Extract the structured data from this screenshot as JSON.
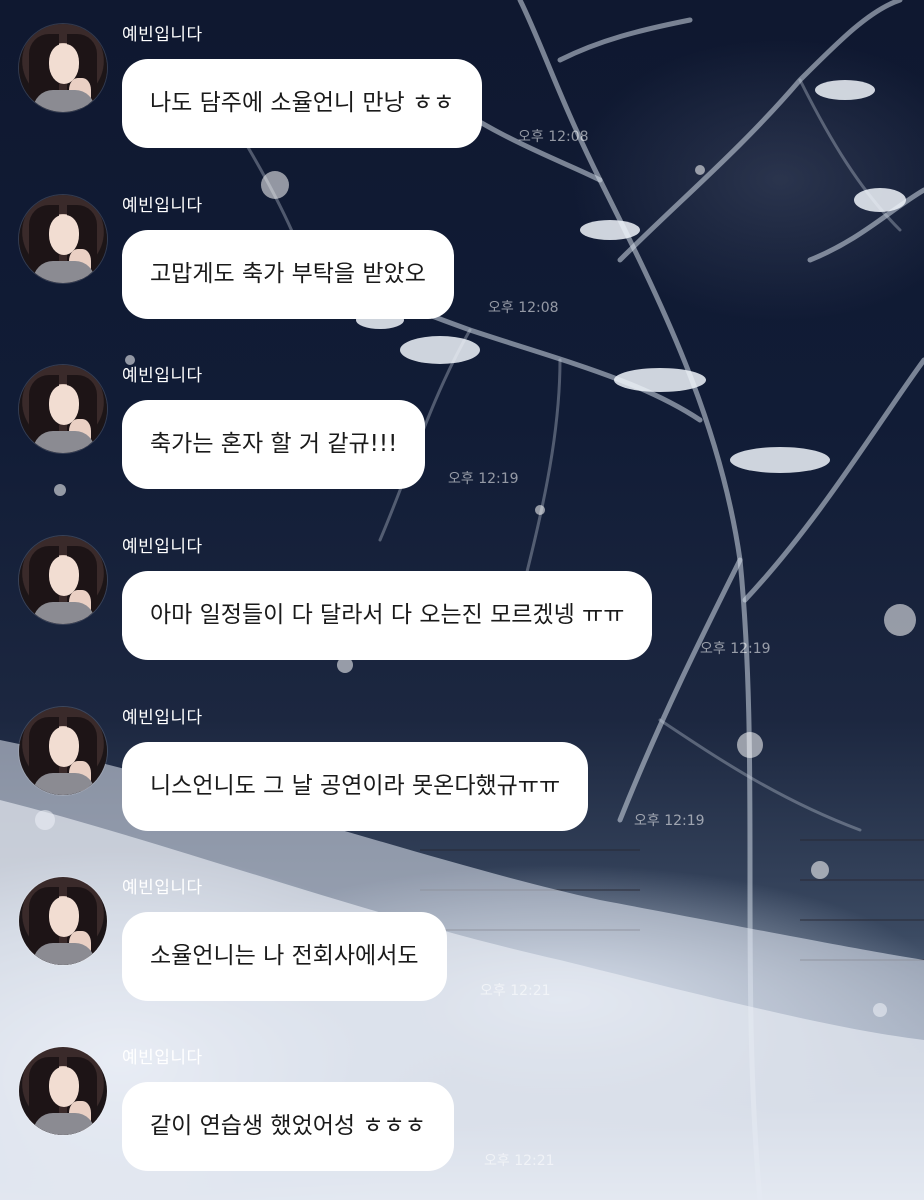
{
  "chat": {
    "messages": [
      {
        "sender": "예빈입니다",
        "text": "나도 담주에 소율언니 만낭 ㅎㅎ",
        "time": "오후 12:08"
      },
      {
        "sender": "예빈입니다",
        "text": "고맙게도 축가 부탁을 받았오",
        "time": "오후 12:08"
      },
      {
        "sender": "예빈입니다",
        "text": "축가는 혼자 할 거 같규!!!",
        "time": "오후 12:19"
      },
      {
        "sender": "예빈입니다",
        "text": "아마 일정들이 다 달라서 다 오는진 모르겠넹 ㅠㅠ",
        "time": "오후 12:19"
      },
      {
        "sender": "예빈입니다",
        "text": "니스언니도 그 날 공연이라 못온다했규ㅠㅠ",
        "time": "오후 12:19"
      },
      {
        "sender": "예빈입니다",
        "text": "소율언니는 나 전회사에서도",
        "time": "오후 12:21"
      },
      {
        "sender": "예빈입니다",
        "text": "같이 연습생 했었어성 ㅎㅎㅎ",
        "time": "오후 12:21"
      }
    ]
  },
  "icons": {
    "avatar": "profile-photo-icon"
  }
}
